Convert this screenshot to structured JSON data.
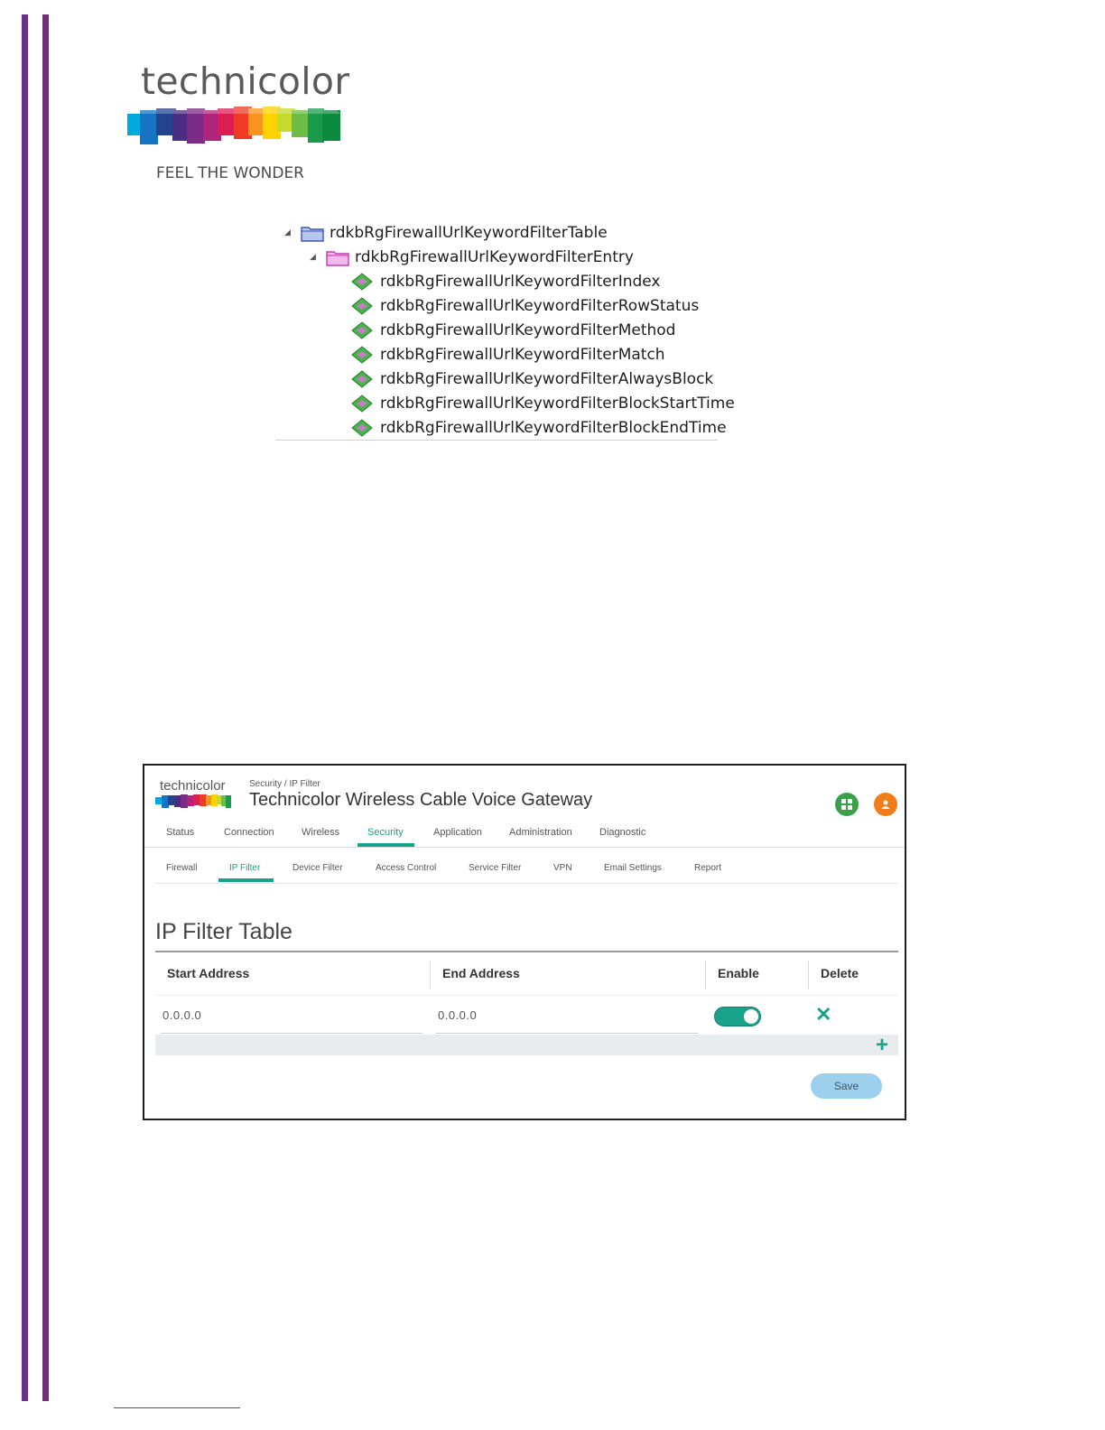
{
  "logo": {
    "wordmark": "technicolor",
    "tagline": "FEEL THE WONDER"
  },
  "tree": {
    "table": "rdkbRgFirewallUrlKeywordFilterTable",
    "entry": "rdkbRgFirewallUrlKeywordFilterEntry",
    "leaves": [
      "rdkbRgFirewallUrlKeywordFilterIndex",
      "rdkbRgFirewallUrlKeywordFilterRowStatus",
      "rdkbRgFirewallUrlKeywordFilterMethod",
      "rdkbRgFirewallUrlKeywordFilterMatch",
      "rdkbRgFirewallUrlKeywordFilterAlwaysBlock",
      "rdkbRgFirewallUrlKeywordFilterBlockStartTime",
      "rdkbRgFirewallUrlKeywordFilterBlockEndTime"
    ]
  },
  "gateway": {
    "logo": "technicolor",
    "breadcrumb": "Security / IP Filter",
    "title": "Technicolor Wireless Cable Voice Gateway",
    "nav": [
      "Status",
      "Connection",
      "Wireless",
      "Security",
      "Application",
      "Administration",
      "Diagnostic"
    ],
    "subnav": [
      "Firewall",
      "IP Filter",
      "Device Filter",
      "Access Control",
      "Service Filter",
      "VPN",
      "Email Settings",
      "Report"
    ],
    "section_title": "IP Filter Table",
    "columns": [
      "Start Address",
      "End Address",
      "Enable",
      "Delete"
    ],
    "rows": [
      {
        "start": "0.0.0.0",
        "end": "0.0.0.0",
        "enabled": true
      }
    ],
    "save_label": "Save",
    "accent_color": "#1aa38b"
  }
}
